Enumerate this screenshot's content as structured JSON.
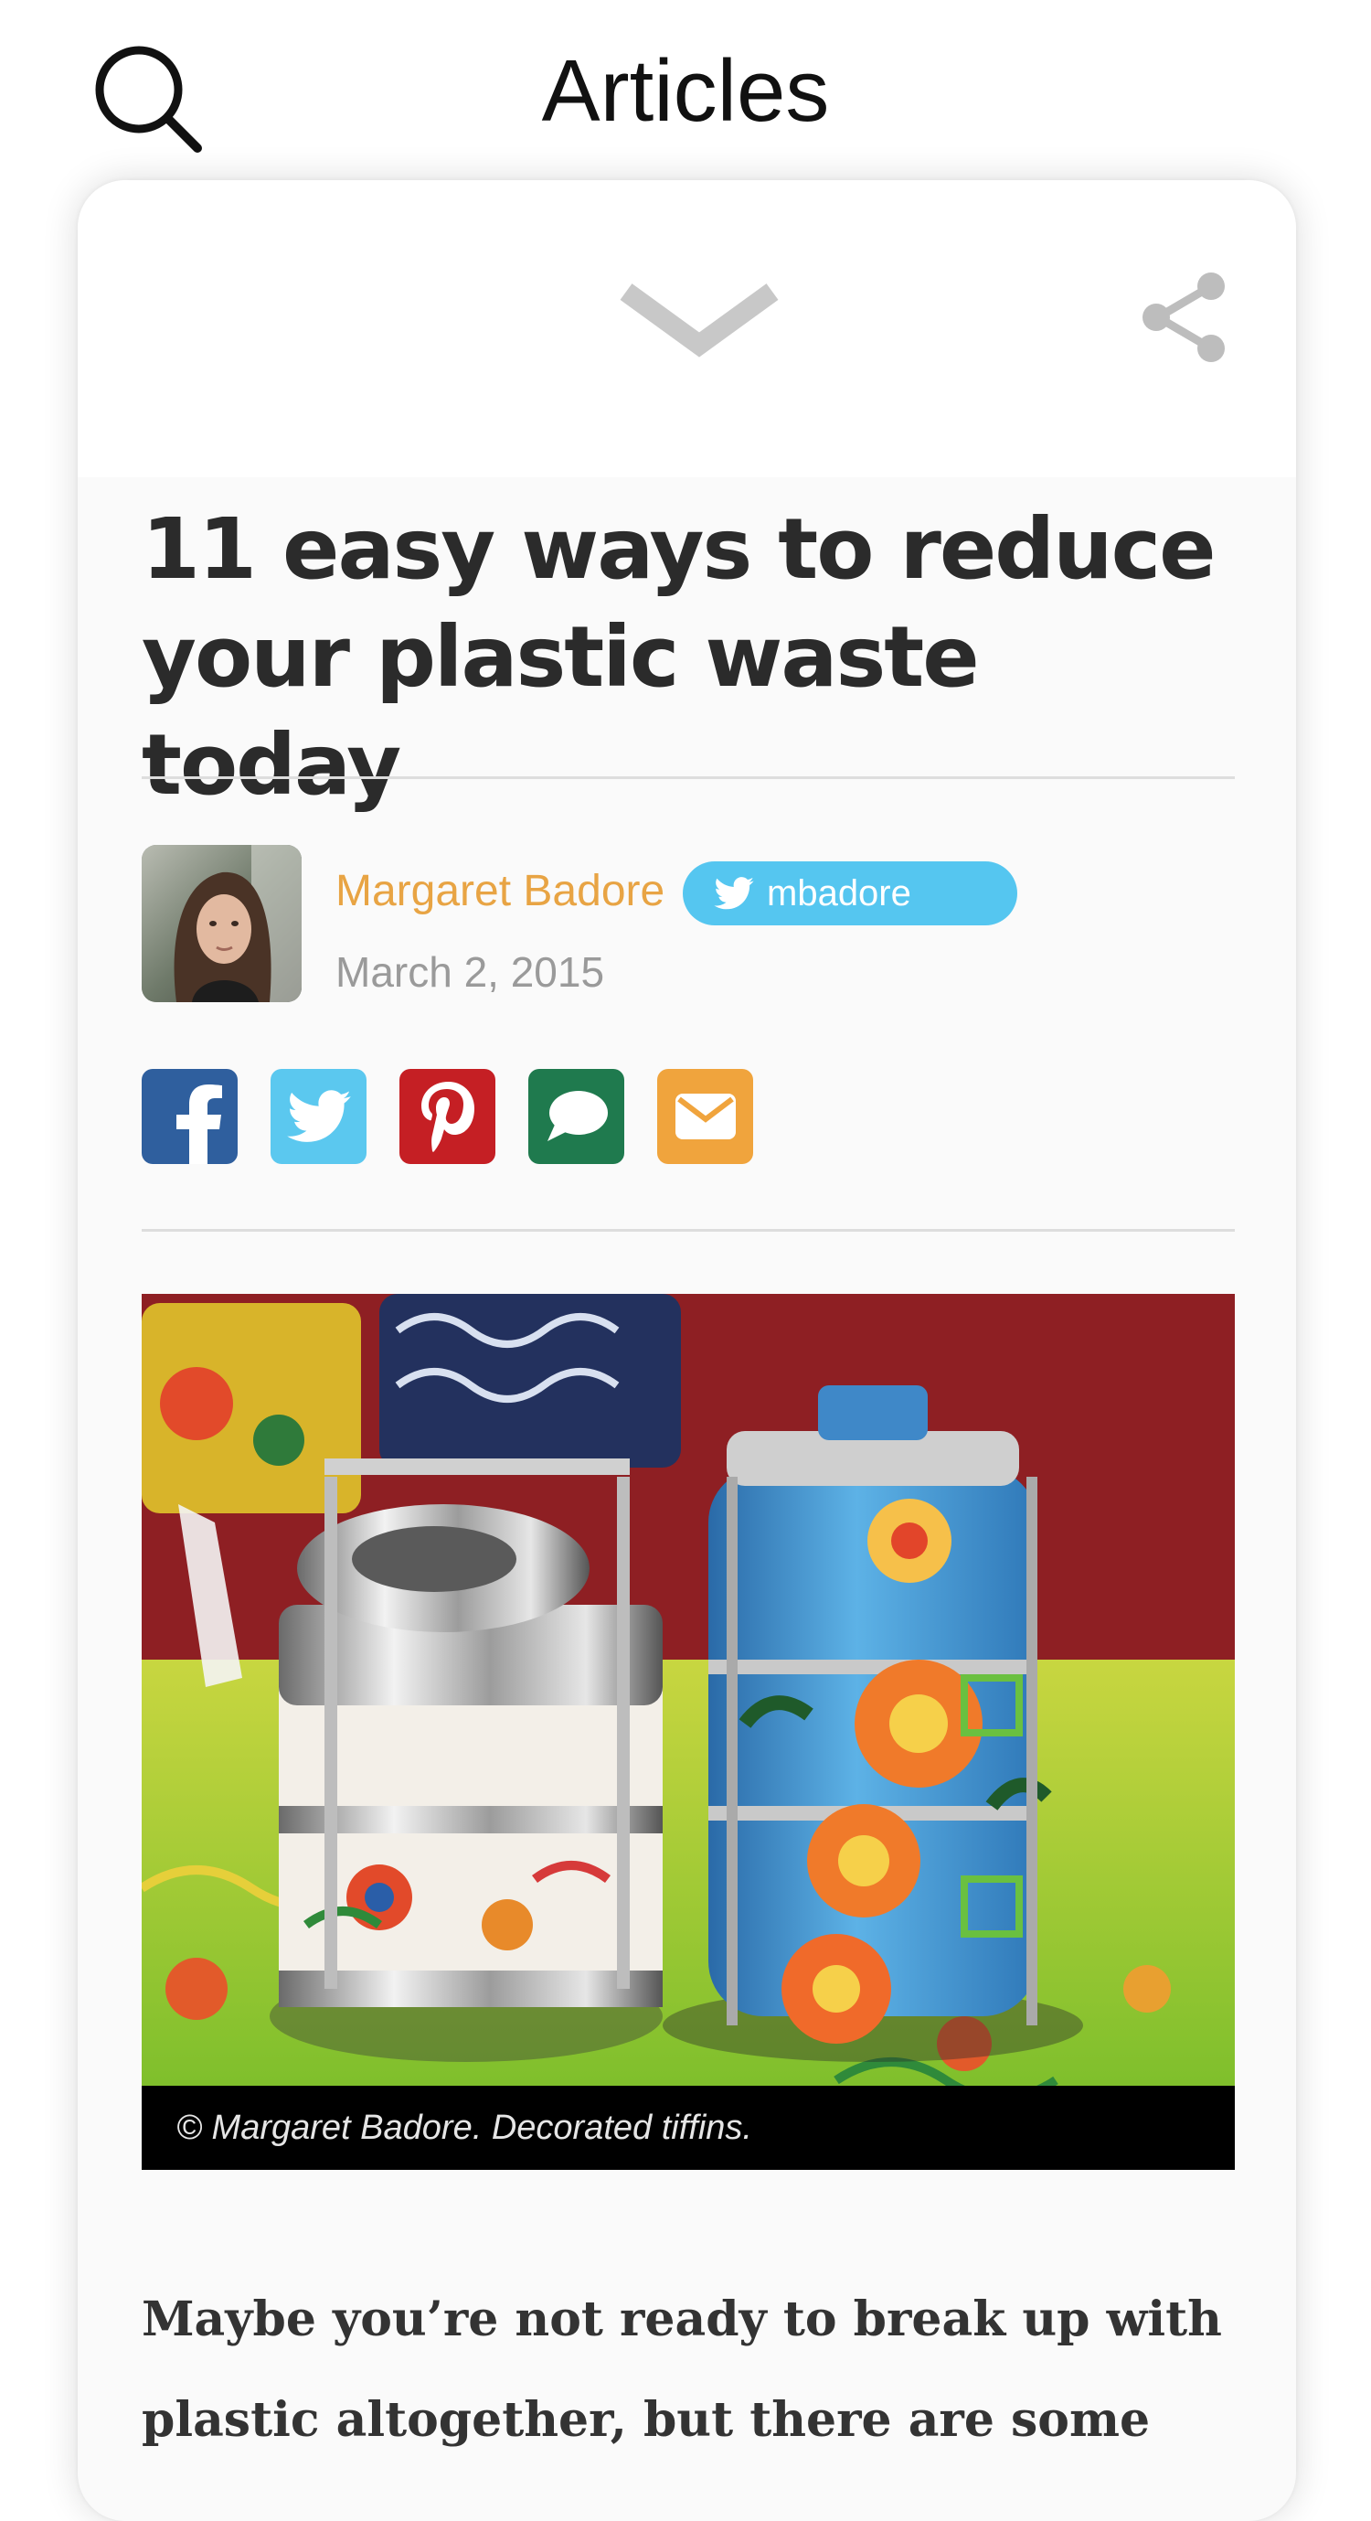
{
  "header": {
    "title": "Articles",
    "search_icon": "search-icon"
  },
  "card": {
    "collapse_icon": "chevron-down-icon",
    "share_icon": "share-icon"
  },
  "article": {
    "title": "11 easy ways to reduce your plastic waste today",
    "author": {
      "name": "Margaret Badore",
      "twitter_handle": "mbadore"
    },
    "date": "March 2, 2015",
    "share_buttons": [
      {
        "name": "facebook",
        "icon": "facebook-icon",
        "color": "#2f5f9e"
      },
      {
        "name": "twitter",
        "icon": "twitter-icon",
        "color": "#5bc8ef"
      },
      {
        "name": "pinterest",
        "icon": "pinterest-icon",
        "color": "#c51f24"
      },
      {
        "name": "message",
        "icon": "speech-bubble-icon",
        "color": "#1f7a4e"
      },
      {
        "name": "email",
        "icon": "envelope-icon",
        "color": "#f0a43d"
      }
    ],
    "image_caption": "© Margaret Badore. Decorated tiffins.",
    "lede": "Maybe you’re not ready to break up with plastic altogether, but there are some"
  },
  "colors": {
    "author_link": "#e8a444",
    "twitter_badge": "#55c6f0",
    "title_text": "#2b2b2b",
    "date_text": "#9a9a9a"
  }
}
